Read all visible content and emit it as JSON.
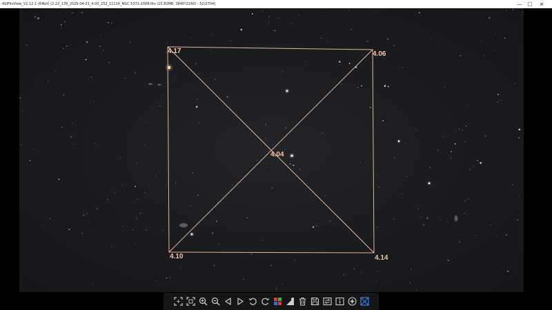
{
  "window": {
    "title": "ASIFitsView_V1.12.1 (64bit) [2.22_139_2025-04-21_4.00_252_11114_NGC 5371-2008.fits (15.82MB, 3840*2160) - 52/2704]",
    "minimize_glyph": "—",
    "maximize_glyph": "☐",
    "close_glyph": "✕"
  },
  "fwhm_overlay": {
    "top_left": "4.17",
    "top_right": "4.06",
    "center": "4.04",
    "bottom_left": "4.10",
    "bottom_right": "4.14"
  },
  "toolbar": {
    "buttons": [
      {
        "name": "fit-to-window-icon"
      },
      {
        "name": "actual-size-icon"
      },
      {
        "name": "zoom-in-icon"
      },
      {
        "name": "zoom-out-icon"
      },
      {
        "name": "previous-icon"
      },
      {
        "name": "next-icon"
      },
      {
        "name": "rotate-left-icon"
      },
      {
        "name": "rotate-right-icon"
      },
      {
        "name": "color-balance-icon"
      },
      {
        "name": "stretch-icon"
      },
      {
        "name": "delete-icon"
      },
      {
        "name": "save-icon"
      },
      {
        "name": "convert-icon"
      },
      {
        "name": "info-icon"
      },
      {
        "name": "star-detect-icon"
      },
      {
        "name": "fwhm-analysis-icon"
      }
    ]
  },
  "colors": {
    "overlay_line": "#e8b59a",
    "overlay_text": "#f2c6a8",
    "active_tool": "#3b82f6",
    "background": "#1d1e22"
  }
}
